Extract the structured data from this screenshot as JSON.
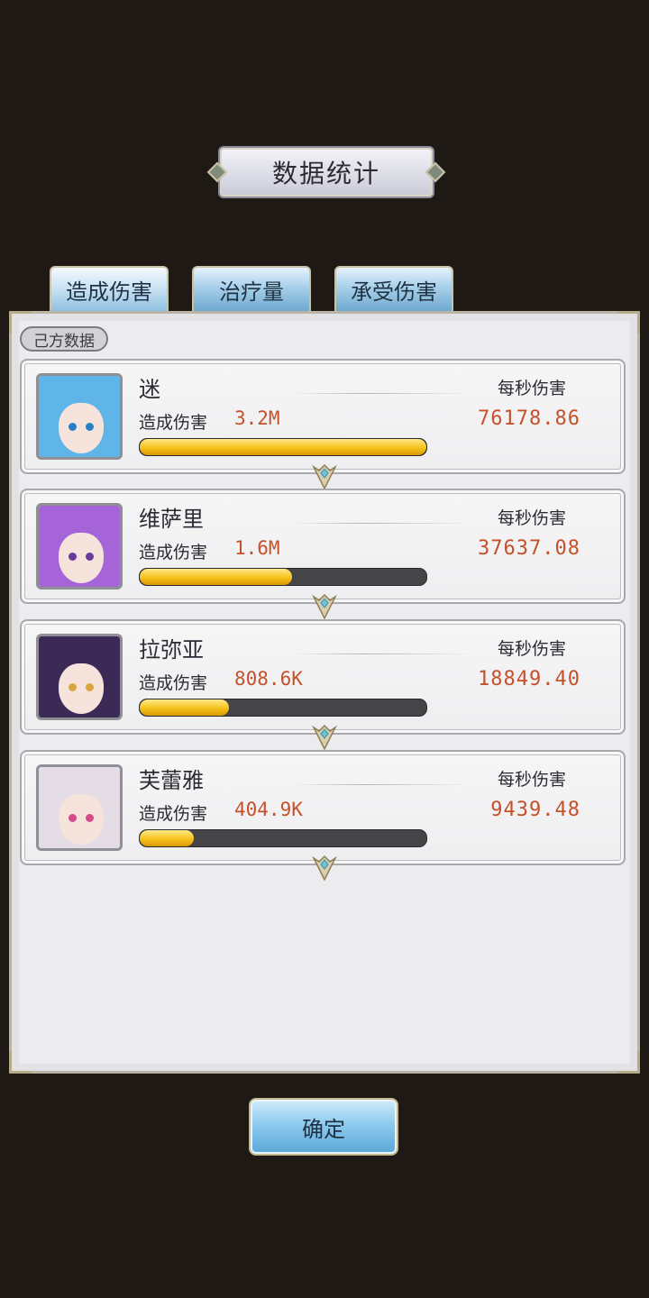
{
  "title": "数据统计",
  "tabs": [
    {
      "label": "造成伤害"
    },
    {
      "label": "治疗量"
    },
    {
      "label": "承受伤害"
    }
  ],
  "section_label": "己方数据",
  "rows": [
    {
      "name": "迷",
      "dmg_label": "造成伤害",
      "dmg_value": "3.2M",
      "dps_label": "每秒伤害",
      "dps_value": "76178.86",
      "bar_fraction": 1.0,
      "hair_color": "#5fb4e8",
      "eye_color": "#2a7fc4"
    },
    {
      "name": "维萨里",
      "dmg_label": "造成伤害",
      "dmg_value": "1.6M",
      "dps_label": "每秒伤害",
      "dps_value": "37637.08",
      "bar_fraction": 0.53,
      "hair_color": "#a565d8",
      "eye_color": "#6a3a9a"
    },
    {
      "name": "拉弥亚",
      "dmg_label": "造成伤害",
      "dmg_value": "808.6K",
      "dps_label": "每秒伤害",
      "dps_value": "18849.40",
      "bar_fraction": 0.31,
      "hair_color": "#3a2a55",
      "eye_color": "#d8a640"
    },
    {
      "name": "芙蕾雅",
      "dmg_label": "造成伤害",
      "dmg_value": "404.9K",
      "dps_label": "每秒伤害",
      "dps_value": "9439.48",
      "bar_fraction": 0.19,
      "hair_color": "#e4dde6",
      "eye_color": "#d44a8a"
    }
  ],
  "confirm_label": "确定",
  "colors": {
    "accent_value": "#c5512a",
    "bar_fill": "#f6c21a",
    "bar_track": "#454548"
  }
}
